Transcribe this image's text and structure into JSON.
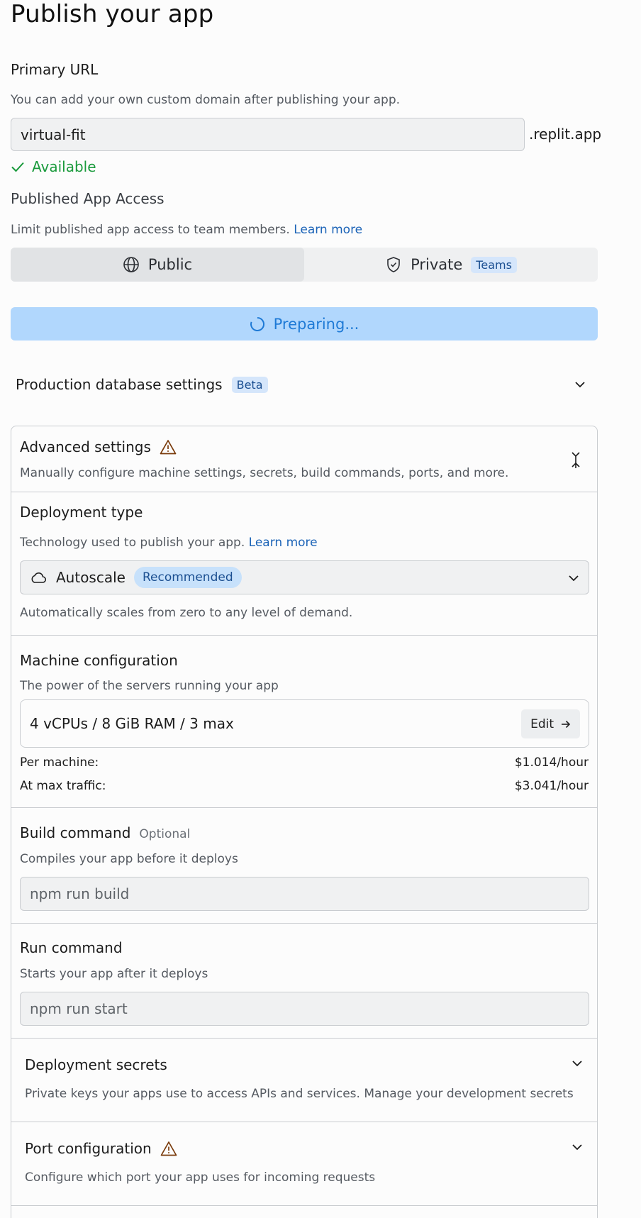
{
  "page": {
    "title": "Publish your app"
  },
  "primary_url": {
    "heading": "Primary URL",
    "description": "You can add your own custom domain after publishing your app.",
    "value": "virtual-fit",
    "suffix": ".replit.app",
    "status": "Available",
    "status_color": "#1a9a3c"
  },
  "access": {
    "heading": "Published App Access",
    "description": "Limit published app access to team members.",
    "learn_more": "Learn more",
    "options": [
      {
        "label": "Public",
        "icon": "globe-icon",
        "selected": true
      },
      {
        "label": "Private",
        "icon": "shield-check-icon",
        "badge": "Teams",
        "selected": false
      }
    ]
  },
  "publish_button": {
    "label": "Preparing...",
    "color": "#b1d7fd"
  },
  "production_db": {
    "label": "Production database settings",
    "badge": "Beta"
  },
  "advanced": {
    "title": "Advanced settings",
    "description": "Manually configure machine settings, secrets, build commands, ports, and more.",
    "deployment_type": {
      "heading": "Deployment type",
      "description": "Technology used to publish your app.",
      "learn_more": "Learn more",
      "selected": "Autoscale",
      "selected_badge": "Recommended",
      "help": "Automatically scales from zero to any level of demand."
    },
    "machine": {
      "heading": "Machine configuration",
      "description": "The power of the servers running your app",
      "value": "4 vCPUs / 8 GiB RAM / 3 max",
      "edit_label": "Edit",
      "per_machine_label": "Per machine:",
      "per_machine_value": "$1.014/hour",
      "max_traffic_label": "At max traffic:",
      "max_traffic_value": "$3.041/hour"
    },
    "build": {
      "heading": "Build command",
      "optional": "Optional",
      "description": "Compiles your app before it deploys",
      "placeholder": "npm run build"
    },
    "run": {
      "heading": "Run command",
      "description": "Starts your app after it deploys",
      "placeholder": "npm run start"
    },
    "secrets": {
      "heading": "Deployment secrets",
      "description": "Private keys your apps use to access APIs and services. Manage your development secrets"
    },
    "ports": {
      "heading": "Port configuration",
      "description": "Configure which port your app uses for incoming requests"
    }
  }
}
